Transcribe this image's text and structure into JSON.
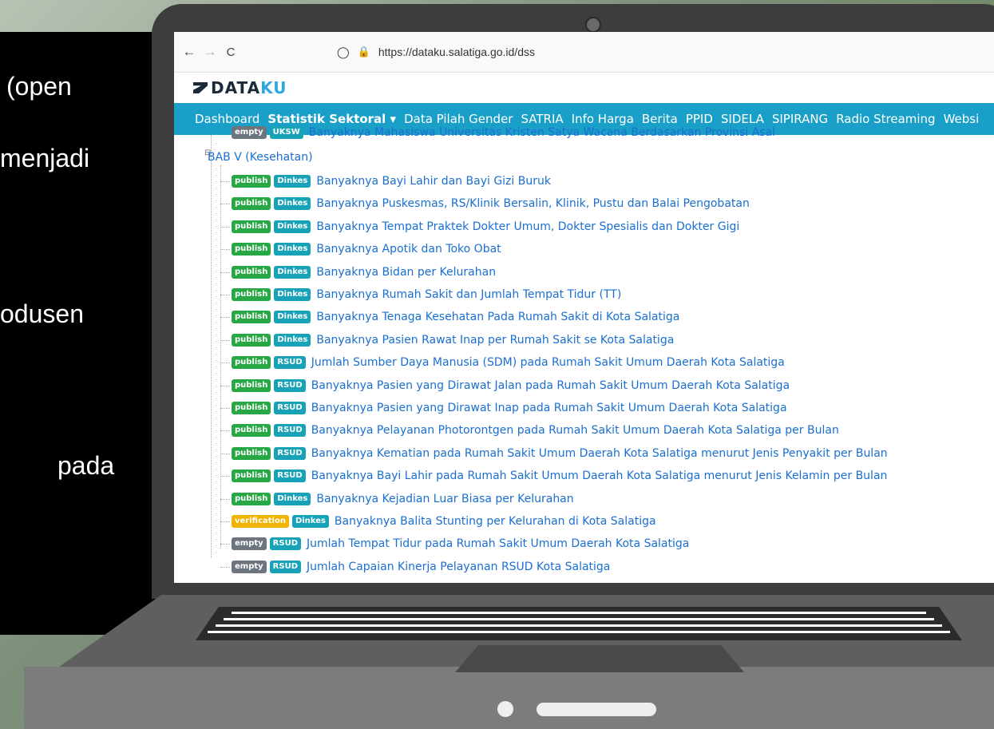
{
  "slide": {
    "lines": [
      "(open",
      "menjadi",
      "odusen",
      "pada"
    ]
  },
  "browser": {
    "back_icon": "←",
    "forward_icon": "→",
    "reload_icon": "C",
    "shield_icon": "◯",
    "lock_icon": "🔒",
    "url": "https://dataku.salatiga.go.id/dss"
  },
  "header": {
    "logo_main": "DATA",
    "logo_accent": "KU"
  },
  "nav": {
    "items": [
      "Dashboard",
      "Statistik Sektoral ▾",
      "Data Pilah Gender",
      "SATRIA",
      "Info Harga",
      "Berita",
      "PPID",
      "SIDELA",
      "SIPIRANG",
      "Radio Streaming",
      "Websi"
    ]
  },
  "tree": {
    "prev_row": {
      "status": "empty",
      "org": "UKSW",
      "title": "Banyaknya Mahasiswa Universitas Kristen Satya Wacana Berdasarkan Provinsi Asal"
    },
    "section_title": "BAB V (Kesehatan)",
    "rows": [
      {
        "status": "publish",
        "org": "Dinkes",
        "title": "Banyaknya Bayi Lahir dan Bayi Gizi Buruk"
      },
      {
        "status": "publish",
        "org": "Dinkes",
        "title": "Banyaknya Puskesmas, RS/Klinik Bersalin, Klinik, Pustu dan Balai Pengobatan"
      },
      {
        "status": "publish",
        "org": "Dinkes",
        "title": "Banyaknya Tempat Praktek Dokter Umum, Dokter Spesialis dan Dokter Gigi"
      },
      {
        "status": "publish",
        "org": "Dinkes",
        "title": "Banyaknya Apotik dan Toko Obat"
      },
      {
        "status": "publish",
        "org": "Dinkes",
        "title": "Banyaknya Bidan per Kelurahan"
      },
      {
        "status": "publish",
        "org": "Dinkes",
        "title": "Banyaknya Rumah Sakit dan Jumlah Tempat Tidur (TT)"
      },
      {
        "status": "publish",
        "org": "Dinkes",
        "title": "Banyaknya Tenaga Kesehatan Pada Rumah Sakit di Kota Salatiga"
      },
      {
        "status": "publish",
        "org": "Dinkes",
        "title": "Banyaknya Pasien Rawat Inap per Rumah Sakit se Kota Salatiga"
      },
      {
        "status": "publish",
        "org": "RSUD",
        "title": "Jumlah Sumber Daya Manusia (SDM) pada Rumah Sakit Umum Daerah Kota Salatiga"
      },
      {
        "status": "publish",
        "org": "RSUD",
        "title": "Banyaknya Pasien yang Dirawat Jalan pada Rumah Sakit Umum Daerah Kota Salatiga"
      },
      {
        "status": "publish",
        "org": "RSUD",
        "title": "Banyaknya Pasien yang Dirawat Inap pada Rumah Sakit Umum Daerah Kota Salatiga"
      },
      {
        "status": "publish",
        "org": "RSUD",
        "title": "Banyaknya Pelayanan Photorontgen pada Rumah Sakit Umum Daerah Kota Salatiga per Bulan"
      },
      {
        "status": "publish",
        "org": "RSUD",
        "title": "Banyaknya Kematian pada Rumah Sakit Umum Daerah Kota Salatiga menurut Jenis Penyakit per Bulan"
      },
      {
        "status": "publish",
        "org": "RSUD",
        "title": "Banyaknya Bayi Lahir pada Rumah Sakit Umum Daerah Kota Salatiga menurut Jenis Kelamin per Bulan"
      },
      {
        "status": "publish",
        "org": "Dinkes",
        "title": "Banyaknya Kejadian Luar Biasa per Kelurahan"
      },
      {
        "status": "verification",
        "org": "Dinkes",
        "title": "Banyaknya Balita Stunting per Kelurahan di Kota Salatiga"
      },
      {
        "status": "empty",
        "org": "RSUD",
        "title": "Jumlah Tempat Tidur pada Rumah Sakit Umum Daerah Kota Salatiga"
      },
      {
        "status": "empty",
        "org": "RSUD",
        "title": "Jumlah Capaian Kinerja Pelayanan RSUD Kota Salatiga"
      }
    ]
  },
  "colors": {
    "navbar": "#1aa0c8",
    "publish": "#28a745",
    "verification": "#f0b400",
    "empty": "#6c757d",
    "org": "#17a2b8",
    "link": "#1a6fd0"
  }
}
